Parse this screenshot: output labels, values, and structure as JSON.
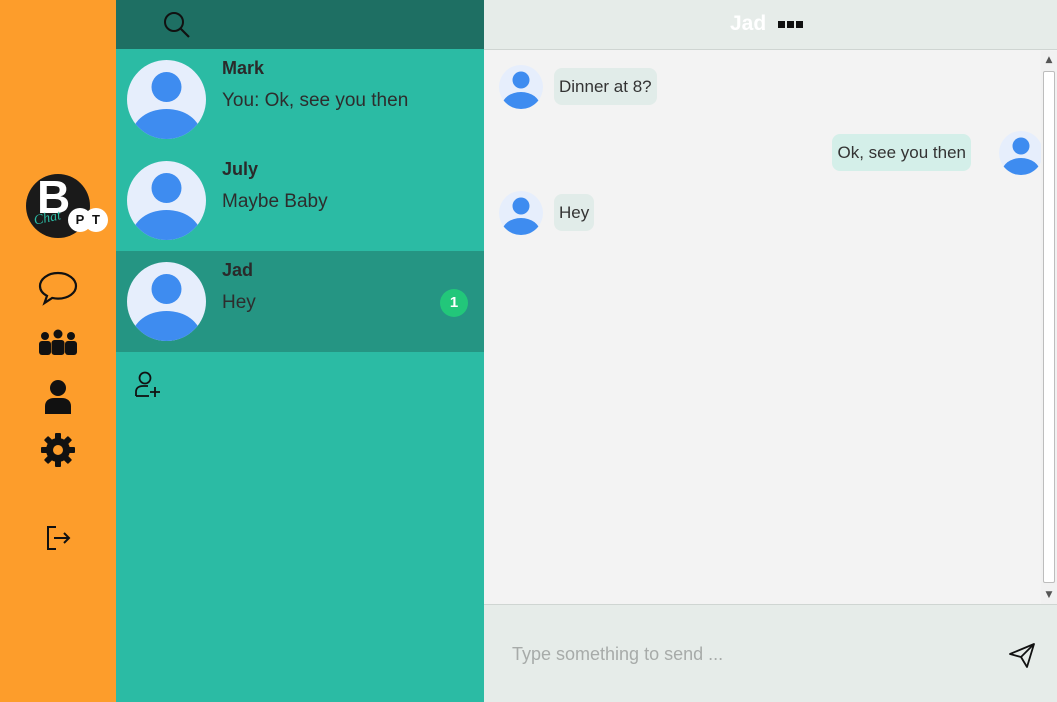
{
  "app": {
    "logo_letter": "B",
    "logo_script": "Chat",
    "logo_p": "P",
    "logo_t": "T"
  },
  "rail": {
    "items": [
      {
        "icon": "chat-bubble-icon"
      },
      {
        "icon": "group-icon"
      },
      {
        "icon": "person-icon"
      },
      {
        "icon": "gear-icon"
      },
      {
        "icon": "logout-icon"
      }
    ]
  },
  "conversations": [
    {
      "name": "Mark",
      "preview": "You: Ok, see you then",
      "unread": ""
    },
    {
      "name": "July",
      "preview": "Maybe Baby",
      "unread": ""
    },
    {
      "name": "Jad",
      "preview": "Hey",
      "unread": "1"
    }
  ],
  "chat": {
    "title": "Jad",
    "messages": [
      {
        "text": "Dinner at 8?",
        "mine": false
      },
      {
        "text": "Ok, see you then",
        "mine": true
      },
      {
        "text": "Hey",
        "mine": false
      }
    ],
    "composer_placeholder": "Type something to send ..."
  },
  "colors": {
    "rail": "#fd9d2b",
    "list": "#2bbba4",
    "list_header": "#1e6f63",
    "active_conversation": "#259583",
    "badge": "#22c77a"
  }
}
